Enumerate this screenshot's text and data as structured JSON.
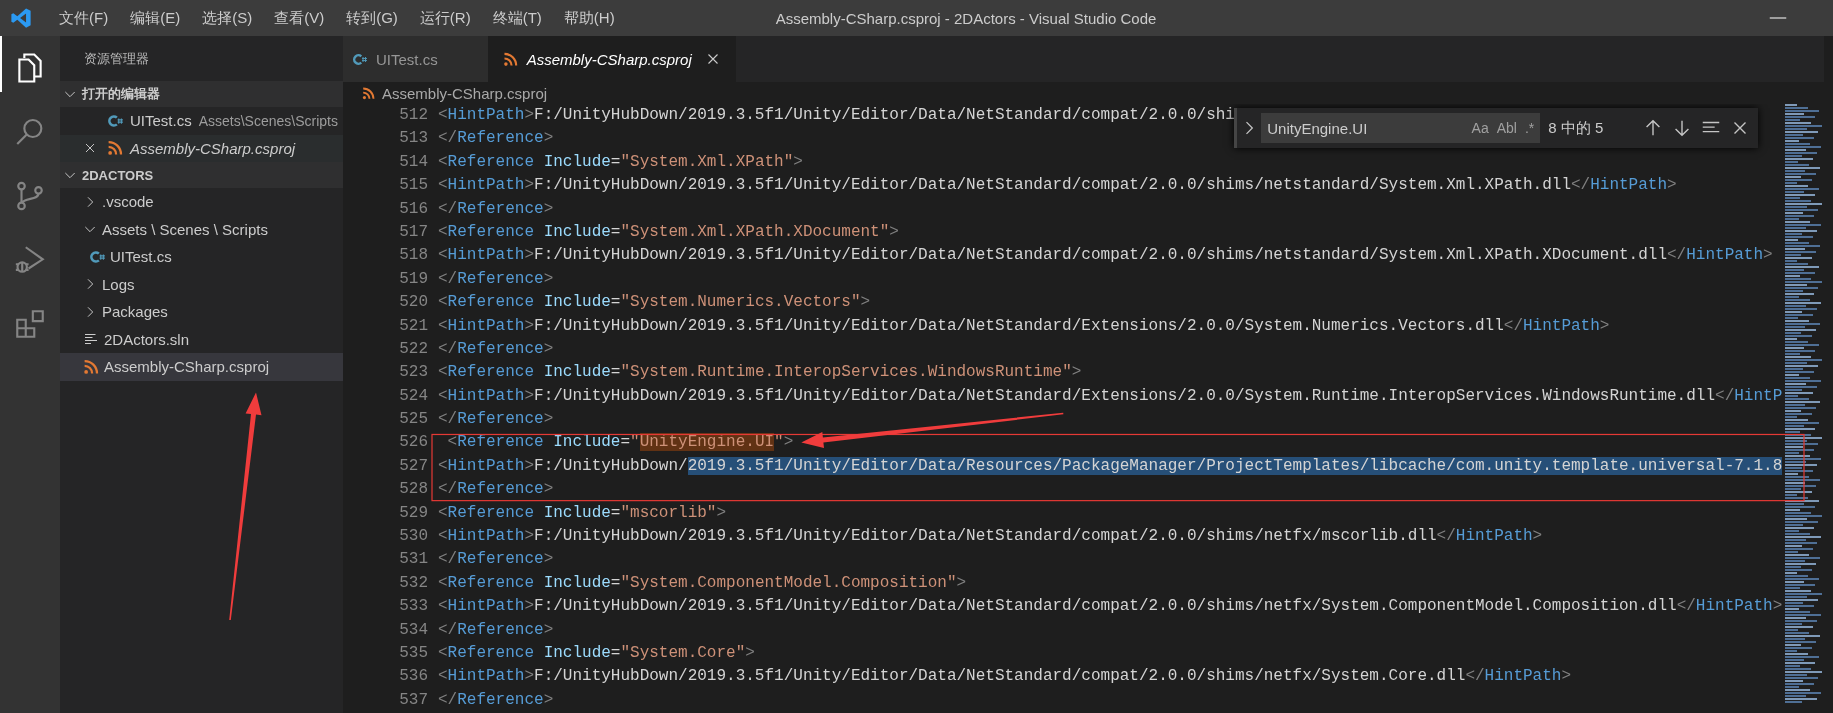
{
  "window": {
    "title": "Assembly-CSharp.csproj - 2DActors - Visual Studio Code"
  },
  "menu": [
    "文件(F)",
    "编辑(E)",
    "选择(S)",
    "查看(V)",
    "转到(G)",
    "运行(R)",
    "终端(T)",
    "帮助(H)"
  ],
  "activity_bar": [
    {
      "kind": "files",
      "selected": true
    },
    {
      "kind": "search",
      "selected": false
    },
    {
      "kind": "source-control",
      "selected": false
    },
    {
      "kind": "debug",
      "selected": false
    },
    {
      "kind": "extensions",
      "selected": false
    }
  ],
  "sidebar": {
    "title": "资源管理器",
    "open_editors": {
      "title": "打开的编辑器",
      "expanded": true,
      "items": [
        {
          "kind": "csharp",
          "name": "UITest.cs",
          "description": "Assets\\Scenes\\Scripts",
          "preview": false,
          "hovered": false
        },
        {
          "kind": "xml",
          "name": "Assembly-CSharp.csproj",
          "preview": true,
          "hovered": true
        }
      ]
    },
    "folder": {
      "title": "2DACTORS",
      "expanded": true,
      "items": [
        {
          "kind": "folder",
          "name": ".vscode",
          "expanded": false,
          "selected": false
        },
        {
          "kind": "folder",
          "name": "Assets \\ Scenes \\ Scripts",
          "expanded": true,
          "selected": false,
          "children": [
            {
              "kind": "csharp",
              "name": "UITest.cs",
              "selected": false
            }
          ]
        },
        {
          "kind": "folder",
          "name": "Logs",
          "expanded": false,
          "selected": false
        },
        {
          "kind": "folder",
          "name": "Packages",
          "expanded": false,
          "selected": false
        },
        {
          "kind": "solution",
          "name": "2DActors.sln",
          "selected": false
        },
        {
          "kind": "xml",
          "name": "Assembly-CSharp.csproj",
          "selected": true
        }
      ]
    }
  },
  "tabs": [
    {
      "kind": "csharp",
      "label": "UITest.cs",
      "selected": false,
      "preview": false
    },
    {
      "kind": "xml",
      "label": "Assembly-CSharp.csproj",
      "selected": true,
      "preview": true
    }
  ],
  "breadcrumb": {
    "kind": "xml",
    "label": "Assembly-CSharp.csproj"
  },
  "find": {
    "replace_expanded": false,
    "query": "UnityEngine.UI",
    "options": [
      "Aa",
      "Abl",
      ".*"
    ],
    "count": "8 中的 5"
  },
  "lines": [
    {
      "number": "512",
      "tokens": [
        {
          "kind": "punct",
          "text": "<"
        },
        {
          "kind": "tag",
          "text": "HintPath"
        },
        {
          "kind": "punct",
          "text": ">"
        },
        {
          "kind": "text",
          "text": "F:/UnityHubDown/2019.3.5f1/Unity/Editor/Data/NetStandard/compat/2.0.0/shi"
        }
      ]
    },
    {
      "number": "513",
      "tokens": [
        {
          "kind": "punct",
          "text": "</"
        },
        {
          "kind": "tag",
          "text": "Reference"
        },
        {
          "kind": "punct",
          "text": ">"
        }
      ]
    },
    {
      "number": "514",
      "tokens": [
        {
          "kind": "punct",
          "text": "<"
        },
        {
          "kind": "tag",
          "text": "Reference"
        },
        {
          "kind": "attr",
          "text": " Include"
        },
        {
          "kind": "text",
          "text": "="
        },
        {
          "kind": "string",
          "text": "\"System.Xml.XPath\""
        },
        {
          "kind": "punct",
          "text": ">"
        }
      ]
    },
    {
      "number": "515",
      "tokens": [
        {
          "kind": "punct",
          "text": "<"
        },
        {
          "kind": "tag",
          "text": "HintPath"
        },
        {
          "kind": "punct",
          "text": ">"
        },
        {
          "kind": "text",
          "text": "F:/UnityHubDown/2019.3.5f1/Unity/Editor/Data/NetStandard/compat/2.0.0/shims/netstandard/System.Xml.XPath.dll"
        },
        {
          "kind": "punct",
          "text": "</"
        },
        {
          "kind": "tag",
          "text": "HintPath"
        },
        {
          "kind": "punct",
          "text": ">"
        }
      ]
    },
    {
      "number": "516",
      "tokens": [
        {
          "kind": "punct",
          "text": "</"
        },
        {
          "kind": "tag",
          "text": "Reference"
        },
        {
          "kind": "punct",
          "text": ">"
        }
      ]
    },
    {
      "number": "517",
      "tokens": [
        {
          "kind": "punct",
          "text": "<"
        },
        {
          "kind": "tag",
          "text": "Reference"
        },
        {
          "kind": "attr",
          "text": " Include"
        },
        {
          "kind": "text",
          "text": "="
        },
        {
          "kind": "string",
          "text": "\"System.Xml.XPath.XDocument\""
        },
        {
          "kind": "punct",
          "text": ">"
        }
      ]
    },
    {
      "number": "518",
      "tokens": [
        {
          "kind": "punct",
          "text": "<"
        },
        {
          "kind": "tag",
          "text": "HintPath"
        },
        {
          "kind": "punct",
          "text": ">"
        },
        {
          "kind": "text",
          "text": "F:/UnityHubDown/2019.3.5f1/Unity/Editor/Data/NetStandard/compat/2.0.0/shims/netstandard/System.Xml.XPath.XDocument.dll"
        },
        {
          "kind": "punct",
          "text": "</"
        },
        {
          "kind": "tag",
          "text": "HintPath"
        },
        {
          "kind": "punct",
          "text": ">"
        }
      ]
    },
    {
      "number": "519",
      "tokens": [
        {
          "kind": "punct",
          "text": "</"
        },
        {
          "kind": "tag",
          "text": "Reference"
        },
        {
          "kind": "punct",
          "text": ">"
        }
      ]
    },
    {
      "number": "520",
      "tokens": [
        {
          "kind": "punct",
          "text": "<"
        },
        {
          "kind": "tag",
          "text": "Reference"
        },
        {
          "kind": "attr",
          "text": " Include"
        },
        {
          "kind": "text",
          "text": "="
        },
        {
          "kind": "string",
          "text": "\"System.Numerics.Vectors\""
        },
        {
          "kind": "punct",
          "text": ">"
        }
      ]
    },
    {
      "number": "521",
      "tokens": [
        {
          "kind": "punct",
          "text": "<"
        },
        {
          "kind": "tag",
          "text": "HintPath"
        },
        {
          "kind": "punct",
          "text": ">"
        },
        {
          "kind": "text",
          "text": "F:/UnityHubDown/2019.3.5f1/Unity/Editor/Data/NetStandard/Extensions/2.0.0/System.Numerics.Vectors.dll"
        },
        {
          "kind": "punct",
          "text": "</"
        },
        {
          "kind": "tag",
          "text": "HintPath"
        },
        {
          "kind": "punct",
          "text": ">"
        }
      ]
    },
    {
      "number": "522",
      "tokens": [
        {
          "kind": "punct",
          "text": "</"
        },
        {
          "kind": "tag",
          "text": "Reference"
        },
        {
          "kind": "punct",
          "text": ">"
        }
      ]
    },
    {
      "number": "523",
      "tokens": [
        {
          "kind": "punct",
          "text": "<"
        },
        {
          "kind": "tag",
          "text": "Reference"
        },
        {
          "kind": "attr",
          "text": " Include"
        },
        {
          "kind": "text",
          "text": "="
        },
        {
          "kind": "string",
          "text": "\"System.Runtime.InteropServices.WindowsRuntime\""
        },
        {
          "kind": "punct",
          "text": ">"
        }
      ]
    },
    {
      "number": "524",
      "tokens": [
        {
          "kind": "punct",
          "text": "<"
        },
        {
          "kind": "tag",
          "text": "HintPath"
        },
        {
          "kind": "punct",
          "text": ">"
        },
        {
          "kind": "text",
          "text": "F:/UnityHubDown/2019.3.5f1/Unity/Editor/Data/NetStandard/Extensions/2.0.0/System.Runtime.InteropServices.WindowsRuntime.dll"
        },
        {
          "kind": "punct",
          "text": "</"
        },
        {
          "kind": "tag",
          "text": "HintP"
        }
      ]
    },
    {
      "number": "525",
      "tokens": [
        {
          "kind": "punct",
          "text": "</"
        },
        {
          "kind": "tag",
          "text": "Reference"
        },
        {
          "kind": "punct",
          "text": ">"
        }
      ]
    },
    {
      "number": "526",
      "tokens": [
        {
          "kind": "punct",
          "text": " <"
        },
        {
          "kind": "tag",
          "text": "Reference"
        },
        {
          "kind": "attr",
          "text": " Include"
        },
        {
          "kind": "text",
          "text": "="
        },
        {
          "kind": "string",
          "text": "\""
        },
        {
          "kind": "match",
          "text": "UnityEngine.UI"
        },
        {
          "kind": "string",
          "text": "\""
        },
        {
          "kind": "punct",
          "text": ">"
        }
      ]
    },
    {
      "number": "527",
      "tokens": [
        {
          "kind": "punct",
          "text": "<"
        },
        {
          "kind": "tag",
          "text": "HintPath"
        },
        {
          "kind": "punct",
          "text": ">"
        },
        {
          "kind": "text",
          "text": "F:/UnityHubDown/"
        },
        {
          "kind": "selection",
          "text": "2019.3.5f1/Unity/Editor/Data/Resources/PackageManager/ProjectTemplates/libcache/com.unity.template.universal-7.1.8"
        }
      ]
    },
    {
      "number": "528",
      "tokens": [
        {
          "kind": "punct",
          "text": "</"
        },
        {
          "kind": "tag",
          "text": "Reference"
        },
        {
          "kind": "punct",
          "text": ">"
        }
      ]
    },
    {
      "number": "529",
      "tokens": [
        {
          "kind": "punct",
          "text": "<"
        },
        {
          "kind": "tag",
          "text": "Reference"
        },
        {
          "kind": "attr",
          "text": " Include"
        },
        {
          "kind": "text",
          "text": "="
        },
        {
          "kind": "string",
          "text": "\"mscorlib\""
        },
        {
          "kind": "punct",
          "text": ">"
        }
      ]
    },
    {
      "number": "530",
      "tokens": [
        {
          "kind": "punct",
          "text": "<"
        },
        {
          "kind": "tag",
          "text": "HintPath"
        },
        {
          "kind": "punct",
          "text": ">"
        },
        {
          "kind": "text",
          "text": "F:/UnityHubDown/2019.3.5f1/Unity/Editor/Data/NetStandard/compat/2.0.0/shims/netfx/mscorlib.dll"
        },
        {
          "kind": "punct",
          "text": "</"
        },
        {
          "kind": "tag",
          "text": "HintPath"
        },
        {
          "kind": "punct",
          "text": ">"
        }
      ]
    },
    {
      "number": "531",
      "tokens": [
        {
          "kind": "punct",
          "text": "</"
        },
        {
          "kind": "tag",
          "text": "Reference"
        },
        {
          "kind": "punct",
          "text": ">"
        }
      ]
    },
    {
      "number": "532",
      "tokens": [
        {
          "kind": "punct",
          "text": "<"
        },
        {
          "kind": "tag",
          "text": "Reference"
        },
        {
          "kind": "attr",
          "text": " Include"
        },
        {
          "kind": "text",
          "text": "="
        },
        {
          "kind": "string",
          "text": "\"System.ComponentModel.Composition\""
        },
        {
          "kind": "punct",
          "text": ">"
        }
      ]
    },
    {
      "number": "533",
      "tokens": [
        {
          "kind": "punct",
          "text": "<"
        },
        {
          "kind": "tag",
          "text": "HintPath"
        },
        {
          "kind": "punct",
          "text": ">"
        },
        {
          "kind": "text",
          "text": "F:/UnityHubDown/2019.3.5f1/Unity/Editor/Data/NetStandard/compat/2.0.0/shims/netfx/System.ComponentModel.Composition.dll"
        },
        {
          "kind": "punct",
          "text": "</"
        },
        {
          "kind": "tag",
          "text": "HintPath"
        },
        {
          "kind": "punct",
          "text": ">"
        }
      ]
    },
    {
      "number": "534",
      "tokens": [
        {
          "kind": "punct",
          "text": "</"
        },
        {
          "kind": "tag",
          "text": "Reference"
        },
        {
          "kind": "punct",
          "text": ">"
        }
      ]
    },
    {
      "number": "535",
      "tokens": [
        {
          "kind": "punct",
          "text": "<"
        },
        {
          "kind": "tag",
          "text": "Reference"
        },
        {
          "kind": "attr",
          "text": " Include"
        },
        {
          "kind": "text",
          "text": "="
        },
        {
          "kind": "string",
          "text": "\"System.Core\""
        },
        {
          "kind": "punct",
          "text": ">"
        }
      ]
    },
    {
      "number": "536",
      "tokens": [
        {
          "kind": "punct",
          "text": "<"
        },
        {
          "kind": "tag",
          "text": "HintPath"
        },
        {
          "kind": "punct",
          "text": ">"
        },
        {
          "kind": "text",
          "text": "F:/UnityHubDown/2019.3.5f1/Unity/Editor/Data/NetStandard/compat/2.0.0/shims/netfx/System.Core.dll"
        },
        {
          "kind": "punct",
          "text": "</"
        },
        {
          "kind": "tag",
          "text": "HintPath"
        },
        {
          "kind": "punct",
          "text": ">"
        }
      ]
    },
    {
      "number": "537",
      "tokens": [
        {
          "kind": "punct",
          "text": "</"
        },
        {
          "kind": "tag",
          "text": "Reference"
        },
        {
          "kind": "punct",
          "text": ">"
        }
      ]
    }
  ],
  "annotations": [
    {
      "kind": "frame"
    },
    {
      "kind": "arrow"
    },
    {
      "kind": "arrow"
    }
  ]
}
